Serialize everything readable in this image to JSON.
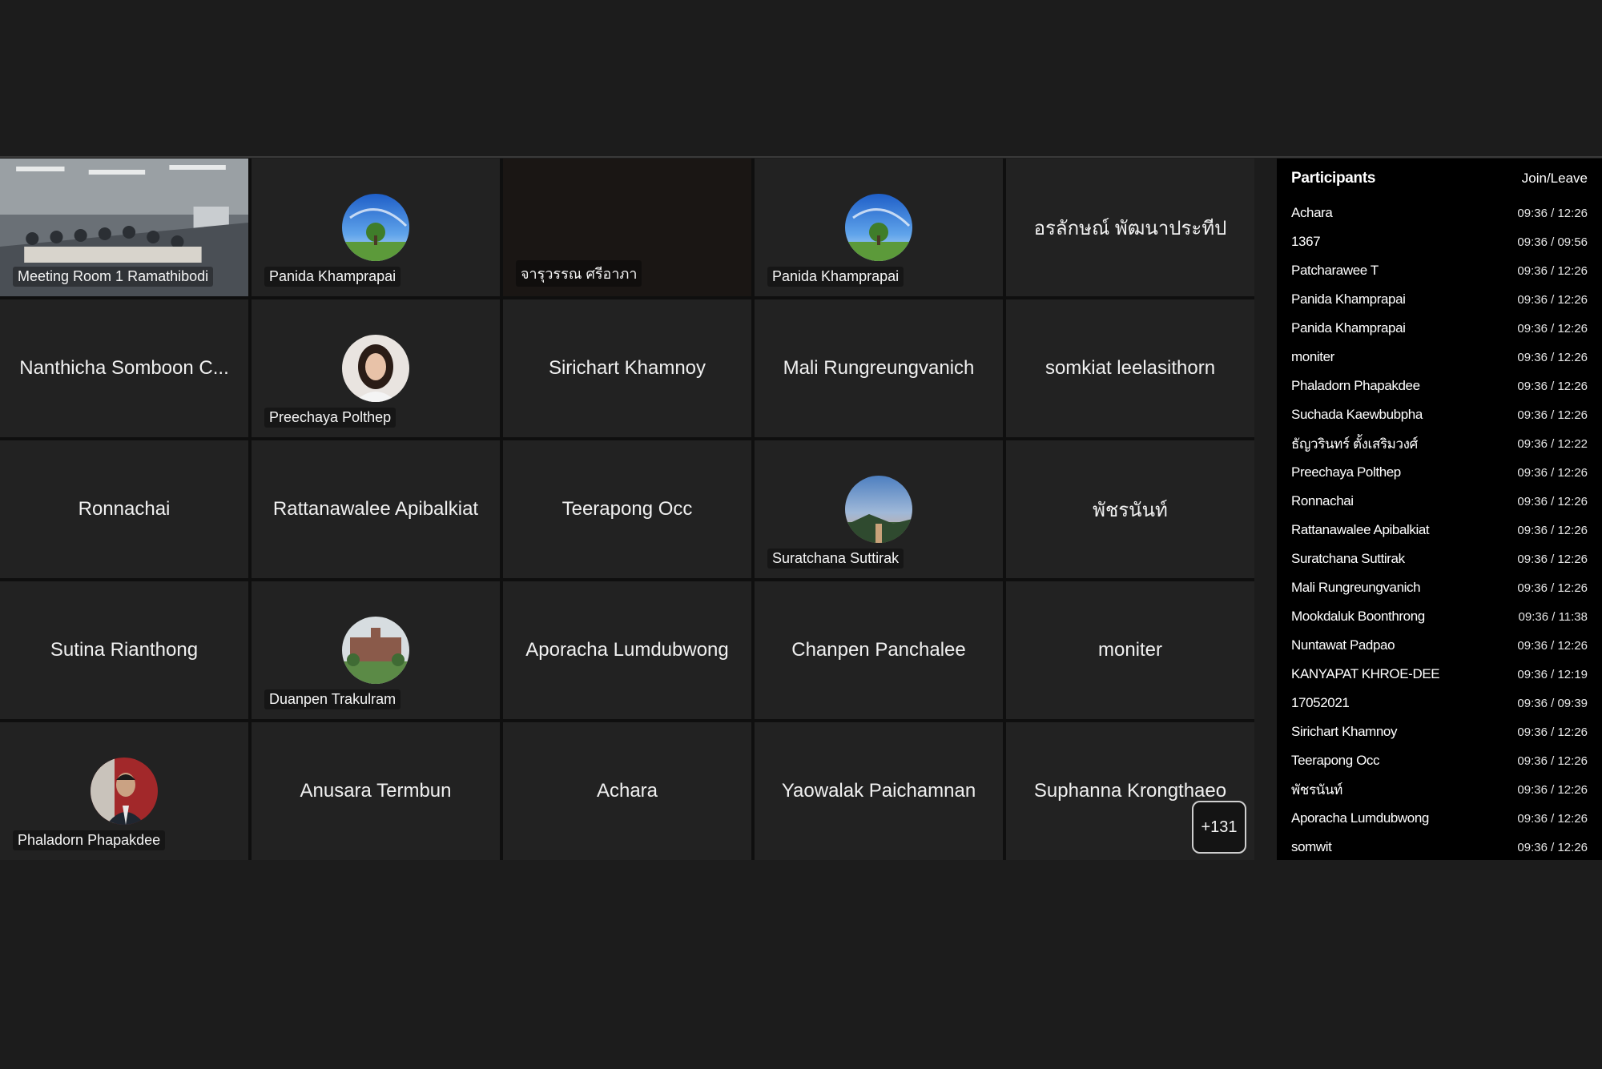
{
  "tiles": [
    {
      "name": "Meeting Room 1 Ramathibodi",
      "kind": "video-room"
    },
    {
      "name": "Panida Khamprapai",
      "kind": "avatar",
      "avatar": "landscape-sky-avatar"
    },
    {
      "name": "จารุวรรณ ศรีอาภา",
      "kind": "dark-video"
    },
    {
      "name": "Panida Khamprapai",
      "kind": "avatar",
      "avatar": "landscape-sky-avatar"
    },
    {
      "name": "อรลักษณ์ พัฒนาประทีป",
      "kind": "name"
    },
    {
      "name": "Nanthicha Somboon C...",
      "kind": "name"
    },
    {
      "name": "Preechaya Polthep",
      "kind": "avatar",
      "avatar": "woman-portrait-avatar"
    },
    {
      "name": "Sirichart Khamnoy",
      "kind": "name"
    },
    {
      "name": "Mali Rungreungvanich",
      "kind": "name"
    },
    {
      "name": "somkiat leelasithorn",
      "kind": "name"
    },
    {
      "name": "Ronnachai",
      "kind": "name"
    },
    {
      "name": "Rattanawalee Apibalkiat",
      "kind": "name"
    },
    {
      "name": "Teerapong Occ",
      "kind": "name"
    },
    {
      "name": "Suratchana Suttirak",
      "kind": "avatar",
      "avatar": "sunset-park-avatar"
    },
    {
      "name": "พัชรนันท์",
      "kind": "name"
    },
    {
      "name": "Sutina Rianthong",
      "kind": "name"
    },
    {
      "name": "Duanpen Trakulram",
      "kind": "avatar",
      "avatar": "garden-building-avatar"
    },
    {
      "name": "Aporacha Lumdubwong",
      "kind": "name"
    },
    {
      "name": "Chanpen Panchalee",
      "kind": "name"
    },
    {
      "name": "moniter",
      "kind": "name"
    },
    {
      "name": "Phaladorn Phapakdee",
      "kind": "avatar",
      "avatar": "man-portrait-avatar"
    },
    {
      "name": "Anusara Termbun",
      "kind": "name"
    },
    {
      "name": "Achara",
      "kind": "name"
    },
    {
      "name": "Yaowalak Paichamnan",
      "kind": "name"
    },
    {
      "name": "Suphanna Krongthaeo",
      "kind": "name"
    }
  ],
  "overflow_count": "+131",
  "panel": {
    "title": "Participants",
    "column_label": "Join/Leave",
    "rows": [
      {
        "name": "Achara",
        "time": "09:36 / 12:26"
      },
      {
        "name": "1367",
        "time": "09:36 / 09:56"
      },
      {
        "name": "Patcharawee T",
        "time": "09:36 / 12:26"
      },
      {
        "name": "Panida Khamprapai",
        "time": "09:36 / 12:26"
      },
      {
        "name": "Panida Khamprapai",
        "time": "09:36 / 12:26"
      },
      {
        "name": "moniter",
        "time": "09:36 / 12:26"
      },
      {
        "name": "Phaladorn Phapakdee",
        "time": "09:36 / 12:26"
      },
      {
        "name": "Suchada Kaewbubpha",
        "time": "09:36 / 12:26"
      },
      {
        "name": "ธัญวรินทร์ ตั้งเสริมวงศ์",
        "time": "09:36 / 12:22"
      },
      {
        "name": "Preechaya Polthep",
        "time": "09:36 / 12:26"
      },
      {
        "name": "Ronnachai",
        "time": "09:36 / 12:26"
      },
      {
        "name": "Rattanawalee Apibalkiat",
        "time": "09:36 / 12:26"
      },
      {
        "name": "Suratchana Suttirak",
        "time": "09:36 / 12:26"
      },
      {
        "name": "Mali Rungreungvanich",
        "time": "09:36 / 12:26"
      },
      {
        "name": "Mookdaluk Boonthrong",
        "time": "09:36 / 11:38"
      },
      {
        "name": "Nuntawat Padpao",
        "time": "09:36 / 12:26"
      },
      {
        "name": "KANYAPAT KHROE-DEE",
        "time": "09:36 / 12:19"
      },
      {
        "name": "17052021",
        "time": "09:36 / 09:39"
      },
      {
        "name": "Sirichart Khamnoy",
        "time": "09:36 / 12:26"
      },
      {
        "name": "Teerapong Occ",
        "time": "09:36 / 12:26"
      },
      {
        "name": "พัชรนันท์",
        "time": "09:36 / 12:26"
      },
      {
        "name": "Aporacha Lumdubwong",
        "time": "09:36 / 12:26"
      },
      {
        "name": "somwit",
        "time": "09:36 / 12:26"
      }
    ]
  }
}
